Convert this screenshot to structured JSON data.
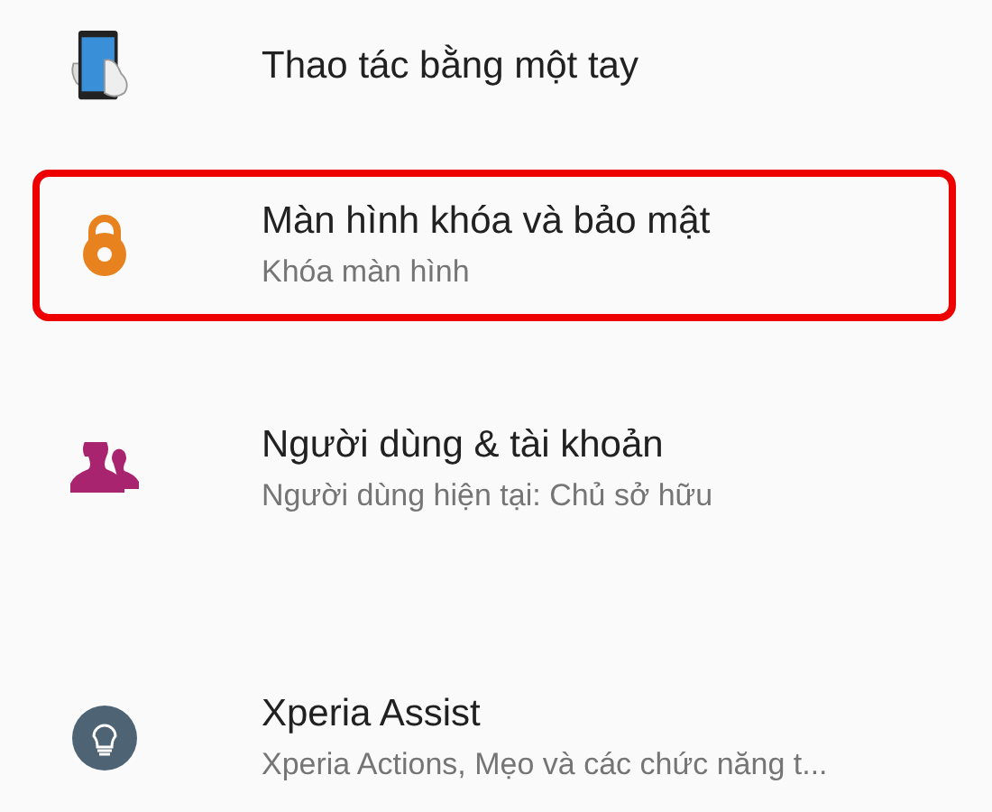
{
  "settings_items": [
    {
      "kind": "phone-hand",
      "title": "Thao tác bằng một tay",
      "highlighted": false
    },
    {
      "kind": "lock",
      "title": "Màn hình khóa và bảo mật",
      "subtitle": "Khóa màn hình",
      "highlighted": true
    },
    {
      "kind": "users",
      "title": "Người dùng & tài khoản",
      "subtitle": "Người dùng hiện tại: Chủ sở hữu",
      "highlighted": false
    },
    {
      "kind": "bulb",
      "title": "Xperia Assist",
      "subtitle": "Xperia Actions, Mẹo và các chức năng t...",
      "highlighted": false
    }
  ]
}
